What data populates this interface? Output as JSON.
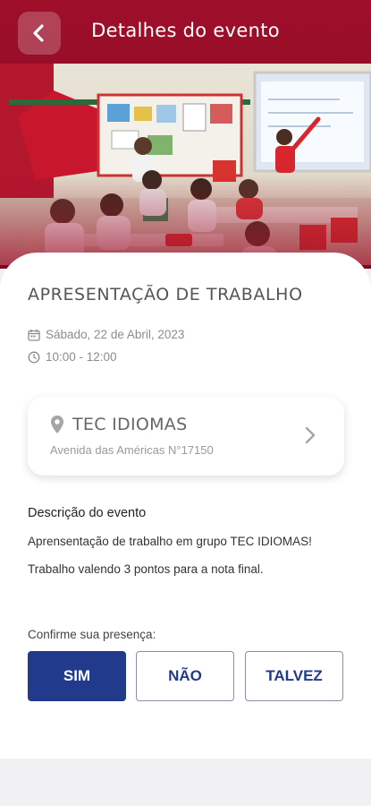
{
  "header": {
    "title": "Detalhes do evento",
    "back_icon": "chevron-left-icon",
    "background_color": "#9f0f2a"
  },
  "event": {
    "title": "APRESENTAÇÃO DE TRABALHO",
    "date": "Sábado, 22 de Abril, 2023",
    "time": "10:00 - 12:00",
    "date_icon": "calendar-icon",
    "time_icon": "clock-icon"
  },
  "location": {
    "name": "TEC IDIOMAS",
    "address": "Avenida das Américas N°17150",
    "icon": "map-pin-icon",
    "arrow_icon": "chevron-right-icon"
  },
  "description": {
    "title": "Descrição do evento",
    "line1": "Aprensentação de trabalho em grupo TEC IDIOMAS!",
    "line2": "Trabalho valendo 3 pontos para a nota final."
  },
  "rsvp": {
    "label": "Confirme sua presença:",
    "yes": "SIM",
    "no": "NÃO",
    "maybe": "TALVEZ",
    "selected": "yes",
    "accent_color": "#223a8c"
  }
}
